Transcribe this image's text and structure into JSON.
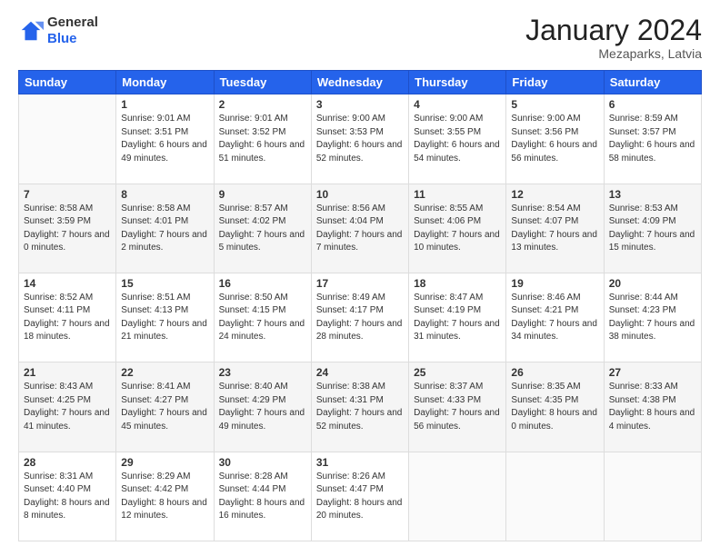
{
  "header": {
    "logo": {
      "line1": "General",
      "line2": "Blue"
    },
    "title": "January 2024",
    "location": "Mezaparks, Latvia"
  },
  "weekdays": [
    "Sunday",
    "Monday",
    "Tuesday",
    "Wednesday",
    "Thursday",
    "Friday",
    "Saturday"
  ],
  "weeks": [
    [
      {
        "day": "",
        "sunrise": "",
        "sunset": "",
        "daylight": ""
      },
      {
        "day": "1",
        "sunrise": "Sunrise: 9:01 AM",
        "sunset": "Sunset: 3:51 PM",
        "daylight": "Daylight: 6 hours and 49 minutes."
      },
      {
        "day": "2",
        "sunrise": "Sunrise: 9:01 AM",
        "sunset": "Sunset: 3:52 PM",
        "daylight": "Daylight: 6 hours and 51 minutes."
      },
      {
        "day": "3",
        "sunrise": "Sunrise: 9:00 AM",
        "sunset": "Sunset: 3:53 PM",
        "daylight": "Daylight: 6 hours and 52 minutes."
      },
      {
        "day": "4",
        "sunrise": "Sunrise: 9:00 AM",
        "sunset": "Sunset: 3:55 PM",
        "daylight": "Daylight: 6 hours and 54 minutes."
      },
      {
        "day": "5",
        "sunrise": "Sunrise: 9:00 AM",
        "sunset": "Sunset: 3:56 PM",
        "daylight": "Daylight: 6 hours and 56 minutes."
      },
      {
        "day": "6",
        "sunrise": "Sunrise: 8:59 AM",
        "sunset": "Sunset: 3:57 PM",
        "daylight": "Daylight: 6 hours and 58 minutes."
      }
    ],
    [
      {
        "day": "7",
        "sunrise": "Sunrise: 8:58 AM",
        "sunset": "Sunset: 3:59 PM",
        "daylight": "Daylight: 7 hours and 0 minutes."
      },
      {
        "day": "8",
        "sunrise": "Sunrise: 8:58 AM",
        "sunset": "Sunset: 4:01 PM",
        "daylight": "Daylight: 7 hours and 2 minutes."
      },
      {
        "day": "9",
        "sunrise": "Sunrise: 8:57 AM",
        "sunset": "Sunset: 4:02 PM",
        "daylight": "Daylight: 7 hours and 5 minutes."
      },
      {
        "day": "10",
        "sunrise": "Sunrise: 8:56 AM",
        "sunset": "Sunset: 4:04 PM",
        "daylight": "Daylight: 7 hours and 7 minutes."
      },
      {
        "day": "11",
        "sunrise": "Sunrise: 8:55 AM",
        "sunset": "Sunset: 4:06 PM",
        "daylight": "Daylight: 7 hours and 10 minutes."
      },
      {
        "day": "12",
        "sunrise": "Sunrise: 8:54 AM",
        "sunset": "Sunset: 4:07 PM",
        "daylight": "Daylight: 7 hours and 13 minutes."
      },
      {
        "day": "13",
        "sunrise": "Sunrise: 8:53 AM",
        "sunset": "Sunset: 4:09 PM",
        "daylight": "Daylight: 7 hours and 15 minutes."
      }
    ],
    [
      {
        "day": "14",
        "sunrise": "Sunrise: 8:52 AM",
        "sunset": "Sunset: 4:11 PM",
        "daylight": "Daylight: 7 hours and 18 minutes."
      },
      {
        "day": "15",
        "sunrise": "Sunrise: 8:51 AM",
        "sunset": "Sunset: 4:13 PM",
        "daylight": "Daylight: 7 hours and 21 minutes."
      },
      {
        "day": "16",
        "sunrise": "Sunrise: 8:50 AM",
        "sunset": "Sunset: 4:15 PM",
        "daylight": "Daylight: 7 hours and 24 minutes."
      },
      {
        "day": "17",
        "sunrise": "Sunrise: 8:49 AM",
        "sunset": "Sunset: 4:17 PM",
        "daylight": "Daylight: 7 hours and 28 minutes."
      },
      {
        "day": "18",
        "sunrise": "Sunrise: 8:47 AM",
        "sunset": "Sunset: 4:19 PM",
        "daylight": "Daylight: 7 hours and 31 minutes."
      },
      {
        "day": "19",
        "sunrise": "Sunrise: 8:46 AM",
        "sunset": "Sunset: 4:21 PM",
        "daylight": "Daylight: 7 hours and 34 minutes."
      },
      {
        "day": "20",
        "sunrise": "Sunrise: 8:44 AM",
        "sunset": "Sunset: 4:23 PM",
        "daylight": "Daylight: 7 hours and 38 minutes."
      }
    ],
    [
      {
        "day": "21",
        "sunrise": "Sunrise: 8:43 AM",
        "sunset": "Sunset: 4:25 PM",
        "daylight": "Daylight: 7 hours and 41 minutes."
      },
      {
        "day": "22",
        "sunrise": "Sunrise: 8:41 AM",
        "sunset": "Sunset: 4:27 PM",
        "daylight": "Daylight: 7 hours and 45 minutes."
      },
      {
        "day": "23",
        "sunrise": "Sunrise: 8:40 AM",
        "sunset": "Sunset: 4:29 PM",
        "daylight": "Daylight: 7 hours and 49 minutes."
      },
      {
        "day": "24",
        "sunrise": "Sunrise: 8:38 AM",
        "sunset": "Sunset: 4:31 PM",
        "daylight": "Daylight: 7 hours and 52 minutes."
      },
      {
        "day": "25",
        "sunrise": "Sunrise: 8:37 AM",
        "sunset": "Sunset: 4:33 PM",
        "daylight": "Daylight: 7 hours and 56 minutes."
      },
      {
        "day": "26",
        "sunrise": "Sunrise: 8:35 AM",
        "sunset": "Sunset: 4:35 PM",
        "daylight": "Daylight: 8 hours and 0 minutes."
      },
      {
        "day": "27",
        "sunrise": "Sunrise: 8:33 AM",
        "sunset": "Sunset: 4:38 PM",
        "daylight": "Daylight: 8 hours and 4 minutes."
      }
    ],
    [
      {
        "day": "28",
        "sunrise": "Sunrise: 8:31 AM",
        "sunset": "Sunset: 4:40 PM",
        "daylight": "Daylight: 8 hours and 8 minutes."
      },
      {
        "day": "29",
        "sunrise": "Sunrise: 8:29 AM",
        "sunset": "Sunset: 4:42 PM",
        "daylight": "Daylight: 8 hours and 12 minutes."
      },
      {
        "day": "30",
        "sunrise": "Sunrise: 8:28 AM",
        "sunset": "Sunset: 4:44 PM",
        "daylight": "Daylight: 8 hours and 16 minutes."
      },
      {
        "day": "31",
        "sunrise": "Sunrise: 8:26 AM",
        "sunset": "Sunset: 4:47 PM",
        "daylight": "Daylight: 8 hours and 20 minutes."
      },
      {
        "day": "",
        "sunrise": "",
        "sunset": "",
        "daylight": ""
      },
      {
        "day": "",
        "sunrise": "",
        "sunset": "",
        "daylight": ""
      },
      {
        "day": "",
        "sunrise": "",
        "sunset": "",
        "daylight": ""
      }
    ]
  ]
}
